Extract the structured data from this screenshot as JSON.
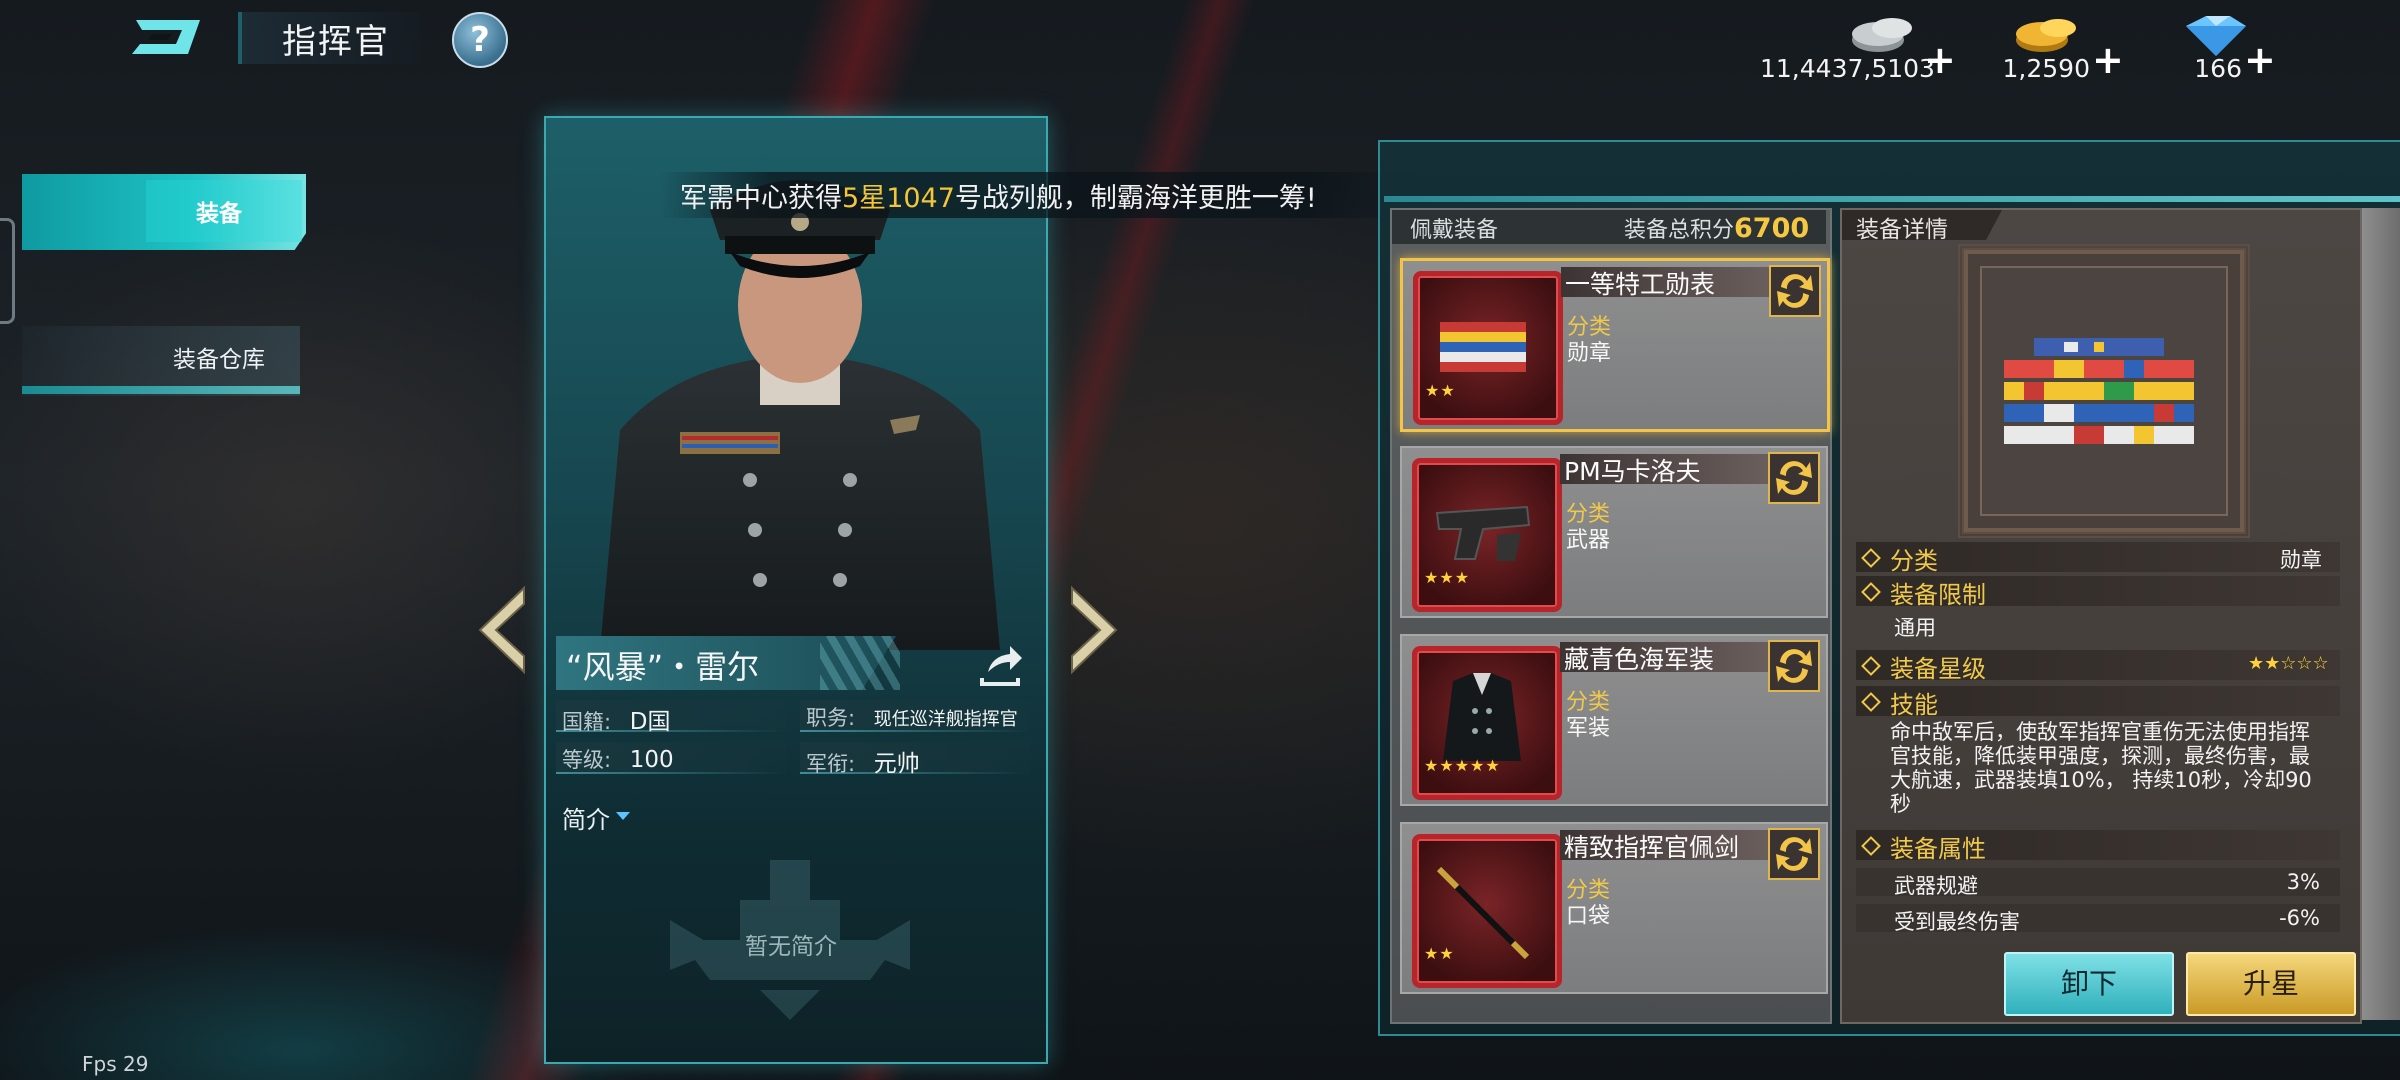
{
  "header": {
    "title": "指挥官",
    "help_label": "?"
  },
  "currencies": [
    {
      "icon": "silver-coins-icon",
      "value": "11,4437,5103"
    },
    {
      "icon": "gold-coins-icon",
      "value": "1,2590"
    },
    {
      "icon": "diamond-icon",
      "value": "166"
    }
  ],
  "plus_symbol": "+",
  "sidebar": {
    "items": [
      {
        "label": "装备",
        "active": true
      },
      {
        "label": "装备仓库",
        "active": false
      }
    ]
  },
  "marquee": {
    "pre": "军需中心获得",
    "hl1": "5星",
    "hl2": "1047",
    "post": "号战列舰，制霸海洋更胜一筹!"
  },
  "commander": {
    "name": "“风暴”・雷尔",
    "nationality_label": "国籍:",
    "nationality": "D国",
    "position_label": "职务:",
    "position": "现任巡洋舰指挥官",
    "level_label": "等级:",
    "level": "100",
    "rank_label": "军衔:",
    "rank": "元帅",
    "brief_label": "简介",
    "no_brief": "暂无简介"
  },
  "equipment": {
    "header_label": "佩戴装备",
    "score_label": "装备总积分",
    "score": "6700",
    "category_label": "分类",
    "items": [
      {
        "name": "一等特工勋表",
        "category": "勋章",
        "stars": "★★",
        "selected": true
      },
      {
        "name": "PM马卡洛夫",
        "category": "武器",
        "stars": "★★★",
        "selected": false
      },
      {
        "name": "藏青色海军装",
        "category": "军装",
        "stars": "★★★★★",
        "selected": false
      },
      {
        "name": "精致指挥官佩剑",
        "category": "口袋",
        "stars": "★★",
        "selected": false
      }
    ]
  },
  "detail": {
    "title": "装备详情",
    "category_label": "分类",
    "category_value": "勋章",
    "restriction_label": "装备限制",
    "restriction_value": "通用",
    "star_label": "装备星级",
    "star_value": "★★☆☆☆",
    "skill_label": "技能",
    "skill_text": "命中敌军后，使敌军指挥官重伤无法使用指挥官技能，降低装甲强度，探测，最终伤害，最大航速，武器装填10%， 持续10秒，冷却90秒",
    "attr_label": "装备属性",
    "attrs": [
      {
        "name": "武器规避",
        "value": "3%"
      },
      {
        "name": "受到最终伤害",
        "value": "-6%"
      }
    ]
  },
  "buttons": {
    "unequip": "卸下",
    "star_up": "升星"
  },
  "fps": "Fps 29",
  "colors": {
    "accent_teal": "#1fc2c4",
    "gold": "#f0c94a",
    "selected_border": "#f2c548"
  }
}
